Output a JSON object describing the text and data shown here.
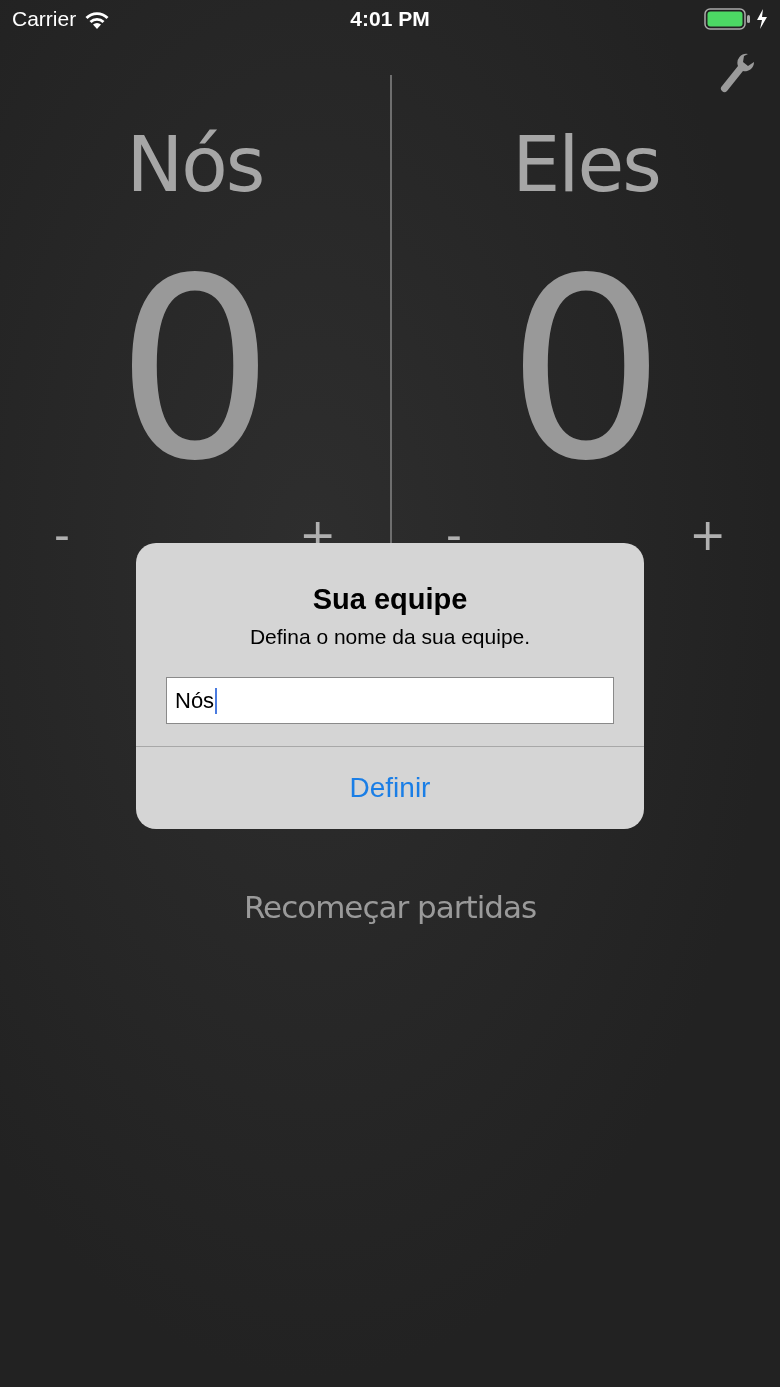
{
  "status_bar": {
    "carrier": "Carrier",
    "time": "4:01 PM"
  },
  "teams": [
    {
      "name": "Nós",
      "score": "0",
      "minus": "-",
      "plus": "+"
    },
    {
      "name": "Eles",
      "score": "0",
      "minus": "-",
      "plus": "+"
    }
  ],
  "restart_button": "Recomeçar partidas",
  "dialog": {
    "title": "Sua equipe",
    "message": "Defina o nome da sua equipe.",
    "input": {
      "value": "Nós"
    },
    "buttons": [
      "Definir"
    ]
  }
}
